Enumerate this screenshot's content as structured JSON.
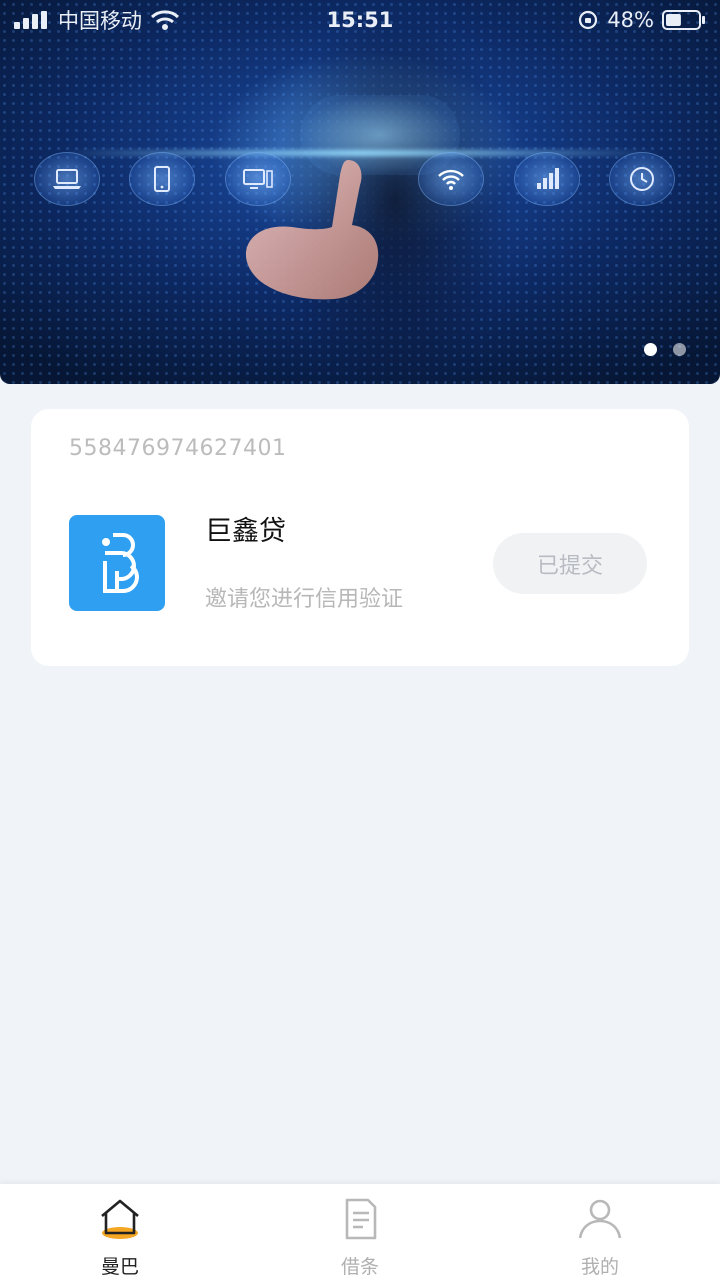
{
  "status_bar": {
    "carrier": "中国移动",
    "time": "15:51",
    "battery": "48%",
    "battery_level": 0.48
  },
  "banner": {
    "slide_count": 2,
    "active_slide": 1
  },
  "card": {
    "order_number": "558476974627401",
    "app_name": "巨鑫贷",
    "app_subtitle": "邀请您进行信用验证",
    "status_button": "已提交",
    "logo_color": "#2f9ff2"
  },
  "tabbar": {
    "tabs": [
      {
        "label": "曼巴",
        "icon": "home-icon",
        "active": true
      },
      {
        "label": "借条",
        "icon": "document-icon",
        "active": false
      },
      {
        "label": "我的",
        "icon": "user-icon",
        "active": false
      }
    ],
    "active_accent": "#f5a623"
  }
}
